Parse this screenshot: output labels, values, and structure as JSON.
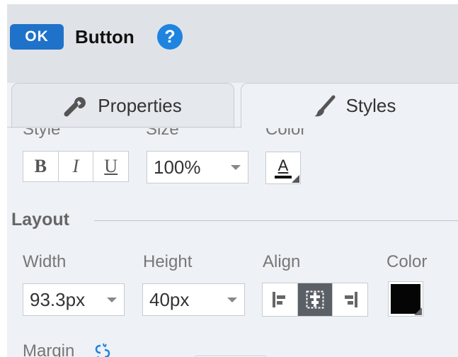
{
  "header": {
    "badge": "OK",
    "title": "Button",
    "help_icon": "question-icon"
  },
  "tabs": [
    {
      "label": "Properties",
      "icon": "wrench-icon",
      "active": false
    },
    {
      "label": "Styles",
      "icon": "brush-icon",
      "active": true
    }
  ],
  "font": {
    "style_label": "Style",
    "size_label": "Size",
    "color_label": "Color",
    "bold": "B",
    "italic": "I",
    "underline": "U",
    "size_value": "100%",
    "color_glyph": "A"
  },
  "layout": {
    "title": "Layout",
    "width_label": "Width",
    "height_label": "Height",
    "align_label": "Align",
    "color_label": "Color",
    "width_value": "93.3px",
    "height_value": "40px",
    "align_selected": "center",
    "color_value": "#050505"
  },
  "margin": {
    "label": "Margin",
    "icon": "link-icon"
  },
  "colors": {
    "accent": "#1f72c9",
    "help": "#1f83e0",
    "panel": "#eef1f5",
    "header": "#dfe3e7"
  }
}
